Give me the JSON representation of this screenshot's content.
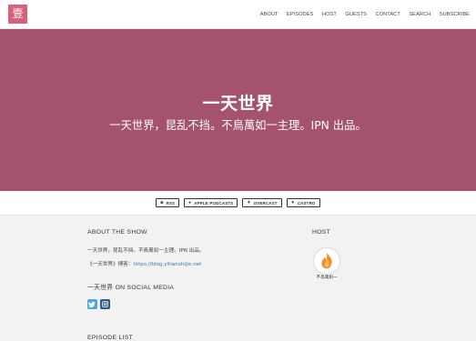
{
  "brand": {
    "logo_char": "壹",
    "logo_color": "#d8607c"
  },
  "nav": {
    "items": [
      "ABOUT",
      "EPISODES",
      "HOST",
      "GUESTS",
      "CONTACT",
      "SEARCH",
      "SUBSCRIBE"
    ]
  },
  "hero": {
    "title": "一天世界",
    "subtitle": "一天世界，昆乱不挡。不鳥萬如一主理。IPN 出品。",
    "background": "#a5536c"
  },
  "subscribe": [
    {
      "icon": "rss-icon",
      "glyph": "◙",
      "label": "RSS"
    },
    {
      "icon": "podcast-icon",
      "glyph": "●",
      "label": "APPLE PODCASTS"
    },
    {
      "icon": "overcast-icon",
      "glyph": "✦",
      "label": "OVERCAST"
    },
    {
      "icon": "castro-icon",
      "glyph": "✦",
      "label": "CASTRO"
    }
  ],
  "about": {
    "title": "ABOUT THE SHOW",
    "line1": "一天世界，昆乱不挡。不鳥萬如一主理。IPN 出品。",
    "blog_prefix": "《一天世界》博客：",
    "blog_link": "https://blog.yitianshijie.net"
  },
  "social": {
    "title": "一天世界 ON SOCIAL MEDIA",
    "twitter_glyph": "🐦",
    "instagram_glyph": "◎"
  },
  "host": {
    "title": "HOST",
    "name": "不鳥萬如一"
  },
  "episodes": {
    "title": "EPISODE LIST"
  }
}
